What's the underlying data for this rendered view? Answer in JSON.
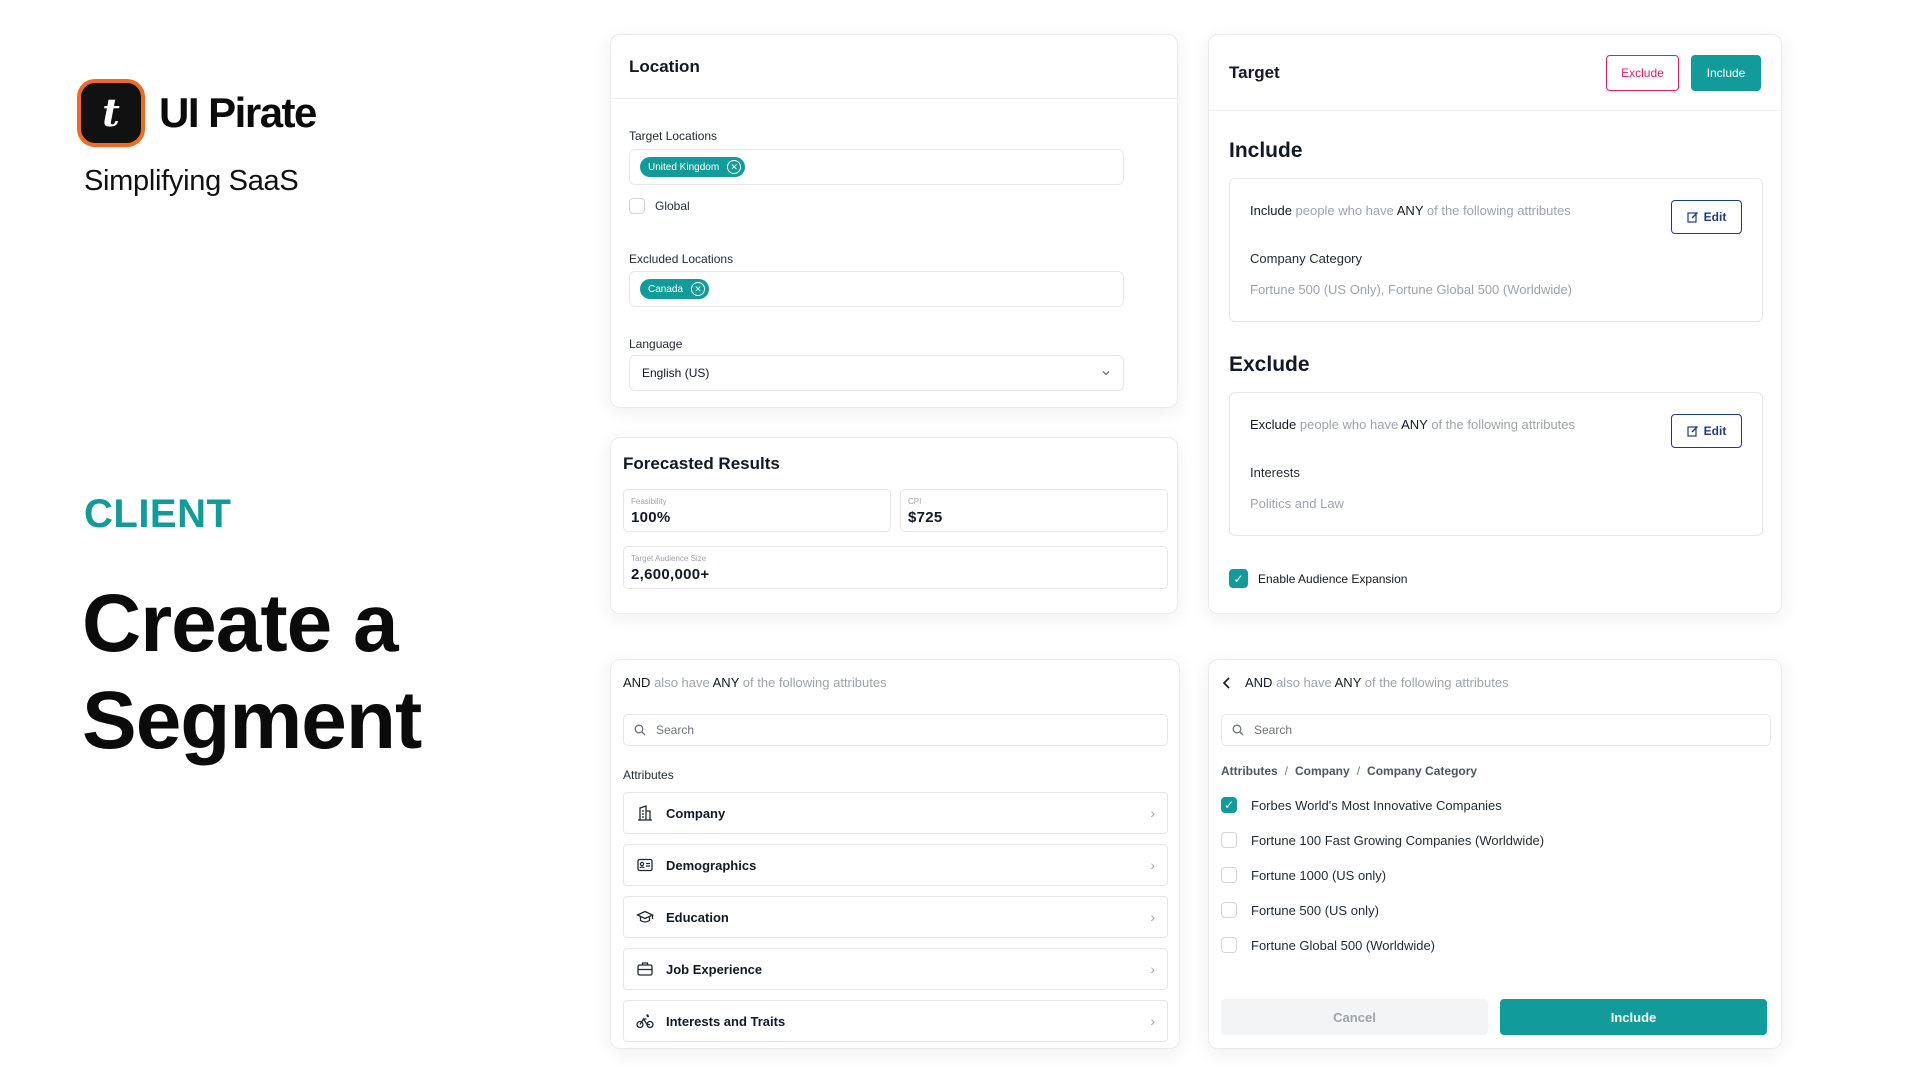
{
  "brand": {
    "logo_glyph": "t",
    "name": "UI Pirate",
    "tagline": "Simplifying SaaS",
    "accent_color": "#f06a23"
  },
  "client_label": "CLIENT",
  "headline": [
    "Create a",
    "Segment"
  ],
  "location": {
    "title": "Location",
    "target_label": "Target Locations",
    "target_chips": [
      "United Kingdom"
    ],
    "global_label": "Global",
    "global_checked": false,
    "excluded_label": "Excluded Locations",
    "excluded_chips": [
      "Canada"
    ],
    "language_label": "Language",
    "language_value": "English (US)"
  },
  "forecast": {
    "title": "Forecasted Results",
    "feasibility_label": "Feasibility",
    "feasibility_value": "100%",
    "cpi_label": "CPI",
    "cpi_value": "$725",
    "audience_label": "Target Audience Size",
    "audience_value": "2,600,000+"
  },
  "target": {
    "title": "Target",
    "exclude_btn": "Exclude",
    "include_btn": "Include",
    "include_section": {
      "heading": "Include",
      "line_verb": "Include",
      "line_mid": "people who have",
      "line_any": "ANY",
      "line_end": "of the following attributes",
      "edit_label": "Edit",
      "category": "Company Category",
      "values": "Fortune 500 (US Only), Fortune Global 500 (Worldwide)"
    },
    "exclude_section": {
      "heading": "Exclude",
      "line_verb": "Exclude",
      "line_mid": "people who have",
      "line_any": "ANY",
      "line_end": "of the following attributes",
      "edit_label": "Edit",
      "category": "Interests",
      "values": "Politics and Law"
    },
    "expansion_label": "Enable Audience Expansion",
    "expansion_checked": true
  },
  "attributes_panel": {
    "and_word": "AND",
    "and_mid": "also have",
    "and_any": "ANY",
    "and_end": "of the following attributes",
    "search_placeholder": "Search",
    "section_label": "Attributes",
    "items": [
      {
        "label": "Company",
        "icon": "building-icon"
      },
      {
        "label": "Demographics",
        "icon": "id-card-icon"
      },
      {
        "label": "Education",
        "icon": "graduation-cap-icon"
      },
      {
        "label": "Job Experience",
        "icon": "briefcase-icon"
      },
      {
        "label": "Interests and Traits",
        "icon": "bicycle-icon"
      }
    ]
  },
  "category_panel": {
    "and_word": "AND",
    "and_mid": "also have",
    "and_any": "ANY",
    "and_end": "of the following attributes",
    "search_placeholder": "Search",
    "breadcrumb": [
      "Attributes",
      "Company",
      "Company Category"
    ],
    "options": [
      {
        "label": "Forbes World's Most Innovative Companies",
        "checked": true
      },
      {
        "label": "Fortune 100 Fast Growing Companies (Worldwide)",
        "checked": false
      },
      {
        "label": "Fortune 1000 (US only)",
        "checked": false
      },
      {
        "label": "Fortune 500 (US only)",
        "checked": false
      },
      {
        "label": "Fortune Global 500 (Worldwide)",
        "checked": false
      }
    ],
    "cancel_label": "Cancel",
    "include_label": "Include"
  },
  "colors": {
    "teal": "#129b9b",
    "pink": "#e11d6a",
    "navy": "#1e3a8a"
  }
}
